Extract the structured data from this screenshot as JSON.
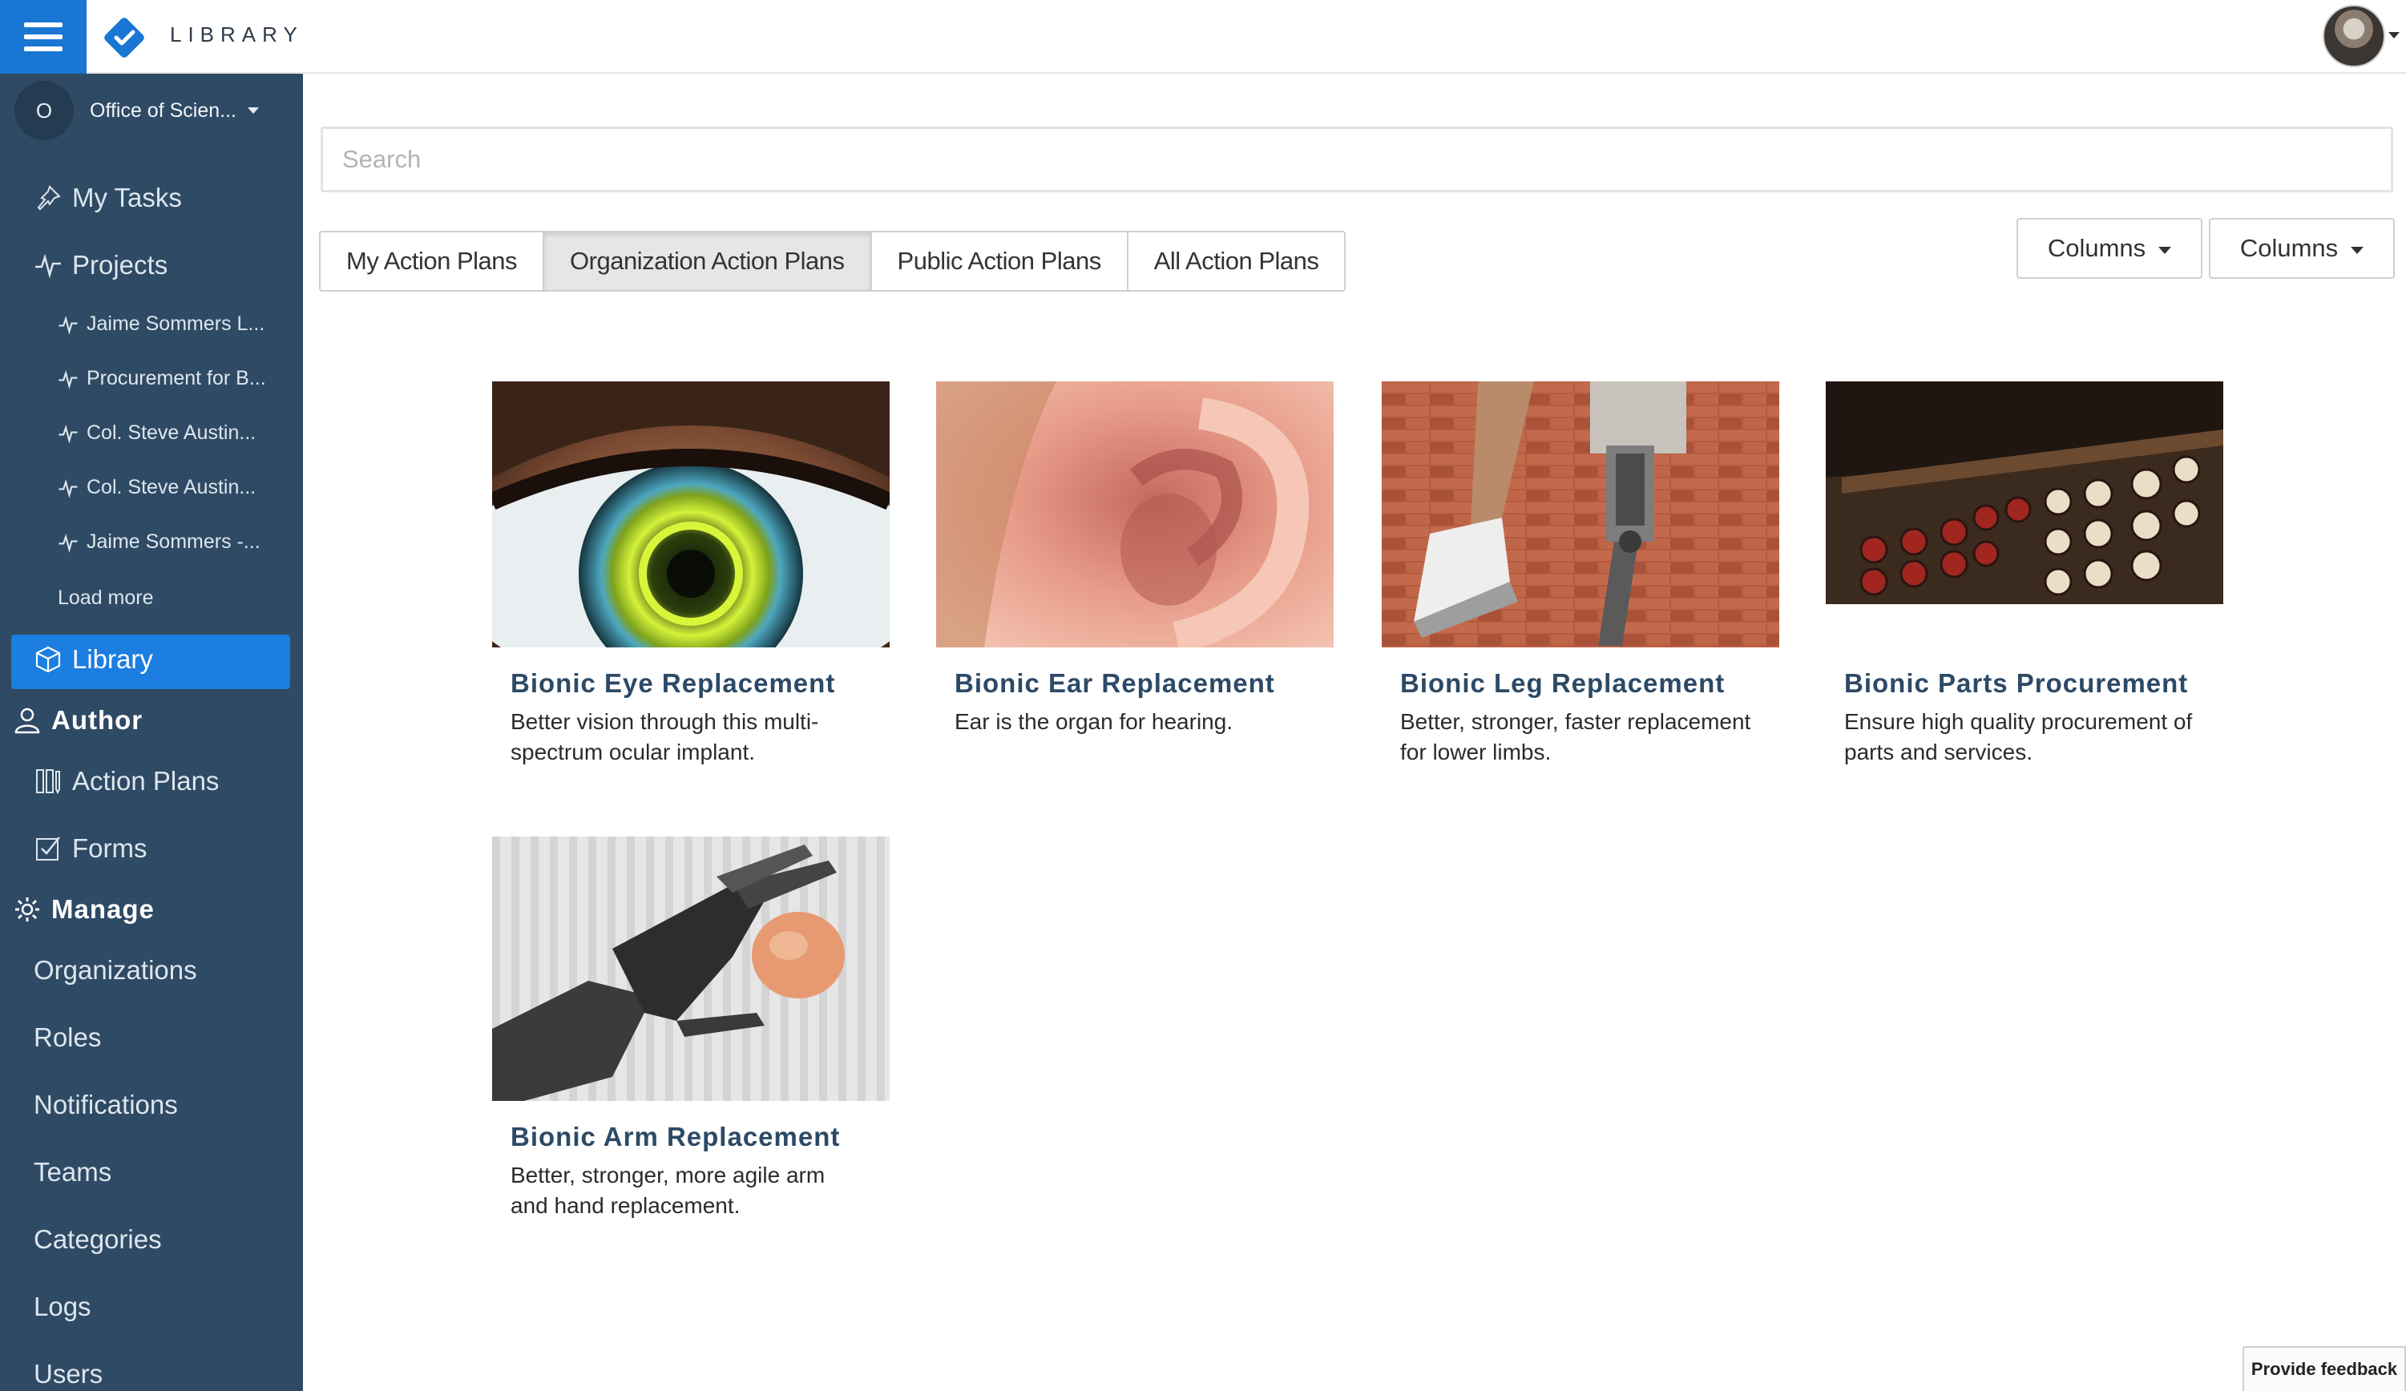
{
  "app": {
    "brand": "LIBRARY"
  },
  "org": {
    "initial": "O",
    "name": "Office of Scien..."
  },
  "sidebar": {
    "my_tasks": "My Tasks",
    "projects": "Projects",
    "project_items": [
      "Jaime Sommers L...",
      "Procurement for B...",
      "Col. Steve Austin...",
      "Col. Steve Austin...",
      "Jaime Sommers -..."
    ],
    "load_more": "Load more",
    "library": "Library",
    "author_heading": "Author",
    "action_plans": "Action Plans",
    "forms": "Forms",
    "manage_heading": "Manage",
    "manage_items": [
      "Organizations",
      "Roles",
      "Notifications",
      "Teams",
      "Categories",
      "Logs",
      "Users"
    ]
  },
  "search": {
    "placeholder": "Search"
  },
  "tabs": [
    {
      "label": "My Action Plans"
    },
    {
      "label": "Organization Action Plans",
      "active": true
    },
    {
      "label": "Public Action Plans"
    },
    {
      "label": "All Action Plans"
    }
  ],
  "column_buttons": [
    "Columns",
    "Columns"
  ],
  "cards": [
    {
      "title": "Bionic Eye Replacement",
      "description": "Better vision through this multi-spectrum ocular implant.",
      "image": "eye"
    },
    {
      "title": "Bionic Ear Replacement",
      "description": "Ear is the organ for hearing.",
      "image": "ear"
    },
    {
      "title": "Bionic Leg Replacement",
      "description": "Better, stronger, faster replacement for lower limbs.",
      "image": "leg"
    },
    {
      "title": "Bionic Parts Procurement",
      "description": "Ensure high quality procurement of parts and services.",
      "image": "register"
    },
    {
      "title": "Bionic Arm Replacement",
      "description": "Better, stronger, more agile arm and hand replacement.",
      "image": "arm"
    }
  ],
  "feedback": {
    "label": "Provide feedback"
  },
  "colors": {
    "sidebar": "#2f4a64",
    "accent": "#1b7ee0",
    "title": "#2c4a66"
  }
}
